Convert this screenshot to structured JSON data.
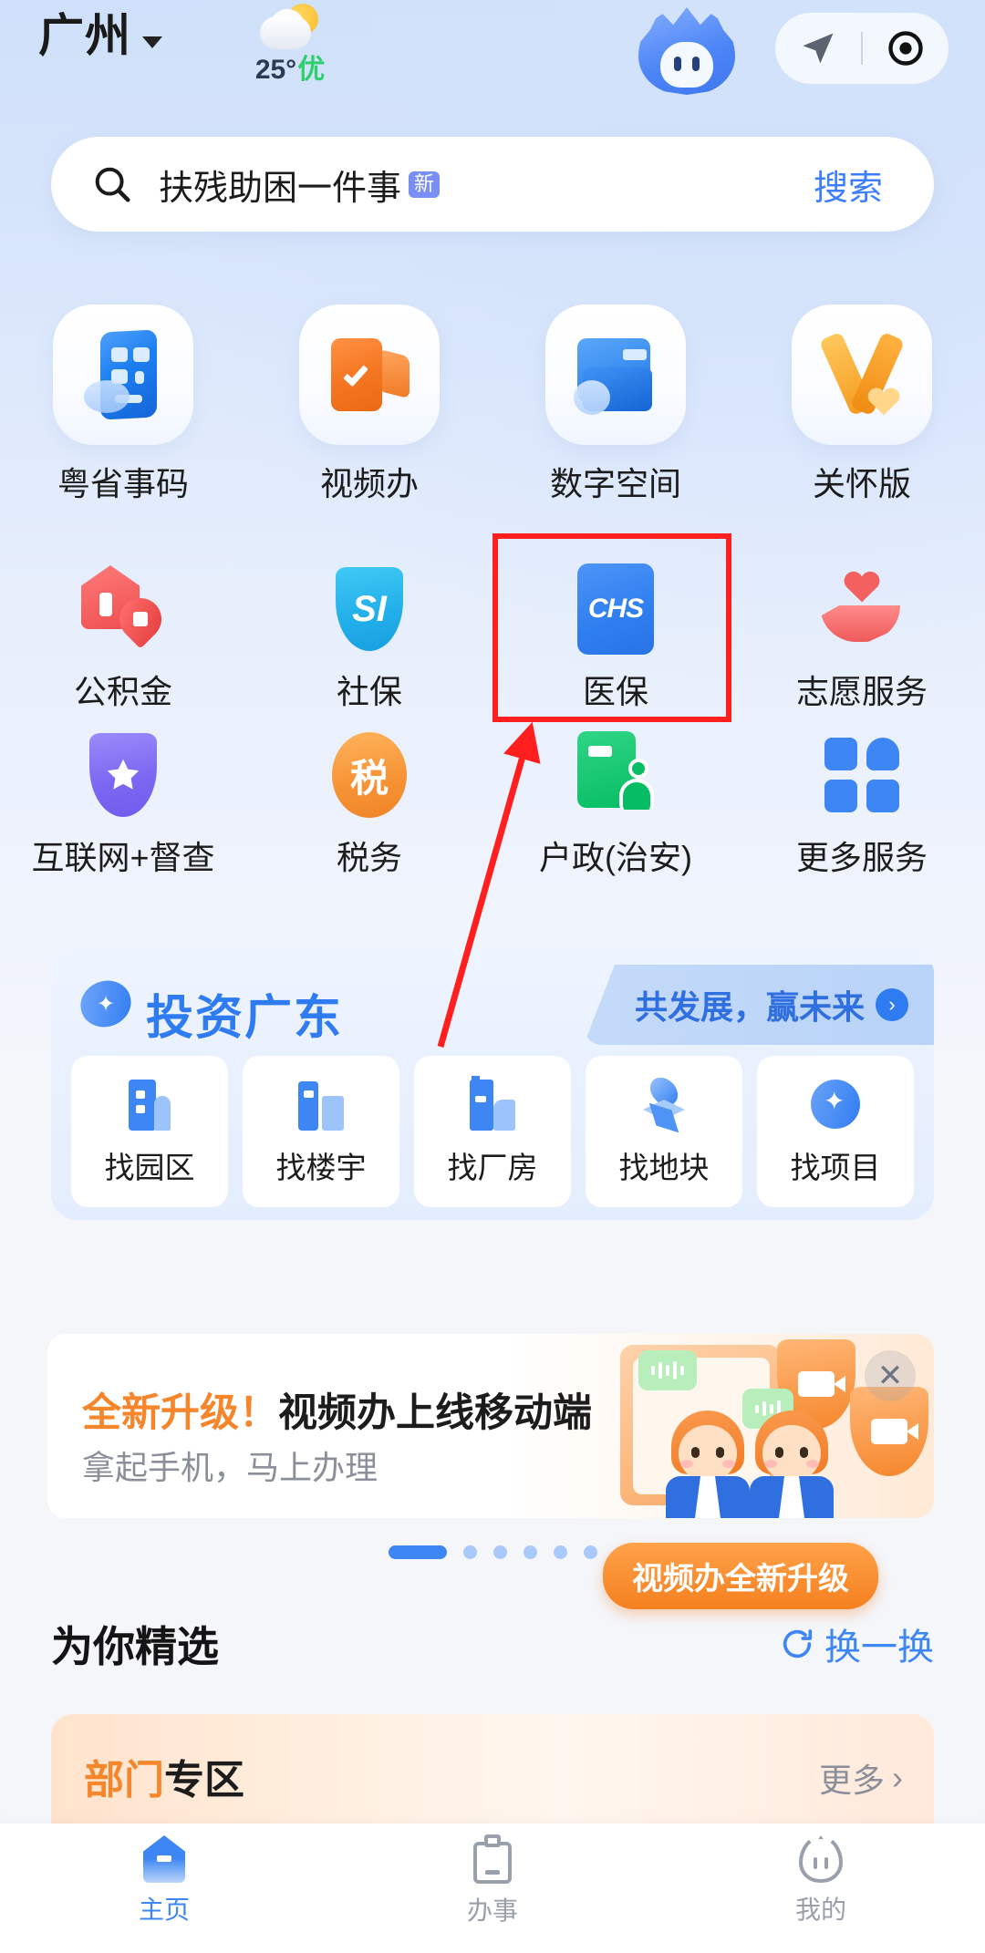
{
  "header": {
    "city": "广州",
    "city_chevron_icon": "chevron-down-icon",
    "weather_icon": "partly-cloudy-icon",
    "temperature": "25°",
    "air_quality": "优",
    "mascot_icon": "mascot-avatar",
    "nav_arrow_icon": "navigation-arrow-icon",
    "target_icon": "target-locate-icon"
  },
  "search": {
    "icon": "search-icon",
    "query": "扶残助困一件事",
    "badge": "新",
    "button_label": "搜索"
  },
  "grid_top": [
    {
      "label": "粤省事码",
      "icon": "qr-code-card-icon"
    },
    {
      "label": "视频办",
      "icon": "video-service-icon"
    },
    {
      "label": "数字空间",
      "icon": "digital-space-folder-icon"
    },
    {
      "label": "关怀版",
      "icon": "care-ribbon-icon"
    }
  ],
  "grid_rest": [
    {
      "label": "公积金",
      "icon": "housing-fund-icon"
    },
    {
      "label": "社保",
      "icon": "social-insurance-shield-icon"
    },
    {
      "label": "医保",
      "icon": "chs-medical-insurance-icon"
    },
    {
      "label": "志愿服务",
      "icon": "volunteer-hand-heart-icon"
    },
    {
      "label": "互联网+督查",
      "icon": "supervision-shield-star-icon"
    },
    {
      "label": "税务",
      "icon": "tax-icon"
    },
    {
      "label": "户政(治安)",
      "icon": "household-police-card-icon"
    },
    {
      "label": "更多服务",
      "icon": "more-services-grid-icon"
    }
  ],
  "invest": {
    "logo_icon": "invest-guangdong-logo-icon",
    "title": "投资广东",
    "chip_text": "共发展，赢未来",
    "chip_arrow_icon": "chevron-right-circle-icon",
    "items": [
      {
        "label": "找园区",
        "icon": "find-park-icon"
      },
      {
        "label": "找楼宇",
        "icon": "find-building-icon"
      },
      {
        "label": "找厂房",
        "icon": "find-factory-icon"
      },
      {
        "label": "找地块",
        "icon": "find-land-pin-icon"
      },
      {
        "label": "找项目",
        "icon": "find-project-icon"
      }
    ]
  },
  "promo": {
    "title_highlight": "全新升级！",
    "title_rest": "视频办上线移动端",
    "subtitle": "拿起手机，马上办理",
    "close_icon": "close-icon",
    "pill_label": "视频办全新升级",
    "pager": {
      "total": 6,
      "active_index": 0
    }
  },
  "picks": {
    "title": "为你精选",
    "refresh_icon": "refresh-icon",
    "refresh_label": "换一换"
  },
  "dept": {
    "title_orange": "部门",
    "title_dark": "专区",
    "more_label": "更多",
    "more_icon": "chevron-right-icon"
  },
  "bottom_nav": [
    {
      "label": "主页",
      "icon": "home-icon",
      "active": true
    },
    {
      "label": "办事",
      "icon": "clipboard-service-icon",
      "active": false
    },
    {
      "label": "我的",
      "icon": "profile-mascot-icon",
      "active": false
    }
  ],
  "annotation": {
    "highlight_target": "医保",
    "box_color": "#ff1f1f",
    "arrow_color": "#ff1f1f"
  }
}
